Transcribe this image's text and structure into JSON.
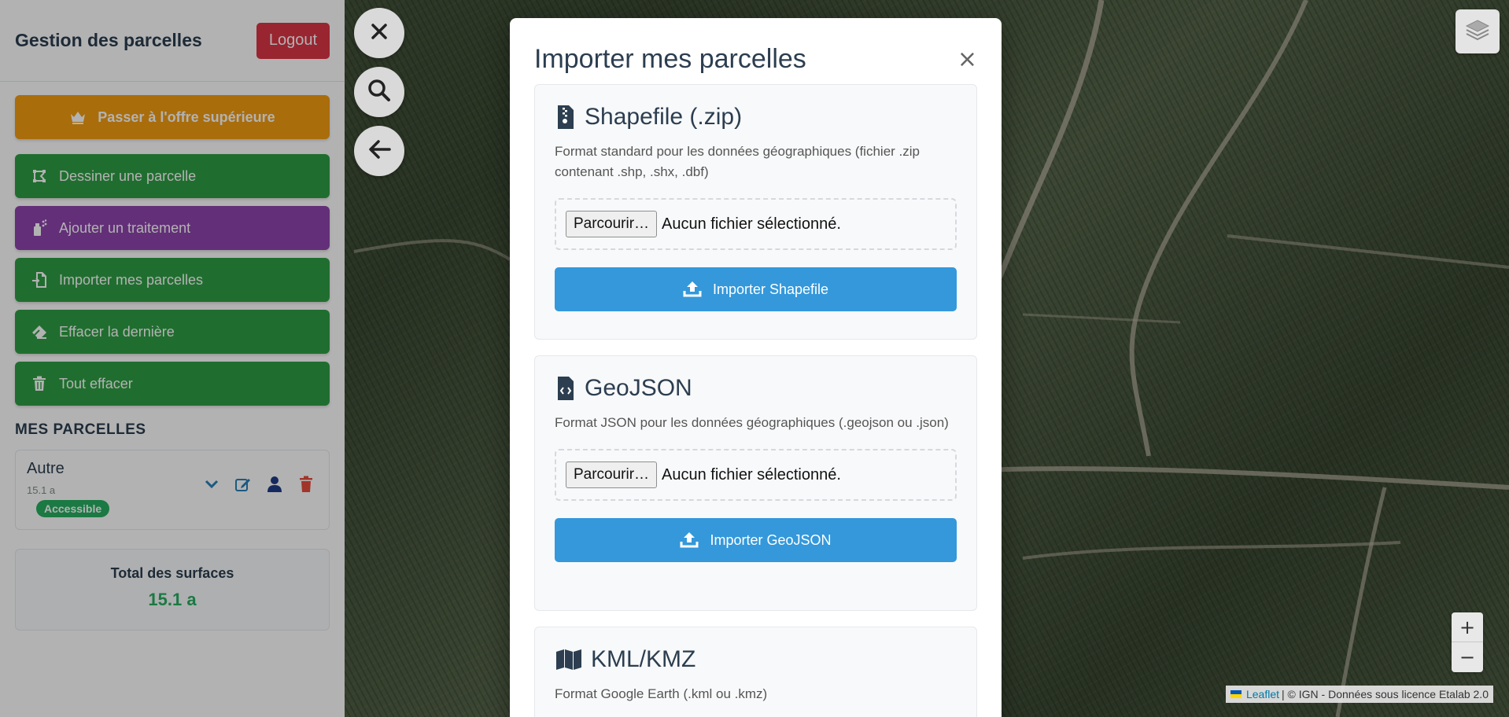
{
  "sidebar": {
    "title": "Gestion des parcelles",
    "logout_label": "Logout",
    "upgrade_label": "Passer à l'offre supérieure",
    "buttons": [
      {
        "label": "Dessiner une parcelle"
      },
      {
        "label": "Ajouter un traitement"
      },
      {
        "label": "Importer mes parcelles"
      },
      {
        "label": "Effacer la dernière"
      },
      {
        "label": "Tout effacer"
      }
    ],
    "section_title": "MES PARCELLES",
    "parcel": {
      "name": "Autre",
      "area": "15.1 a",
      "badge": "Accessible"
    },
    "total": {
      "label": "Total des surfaces",
      "value": "15.1 a"
    }
  },
  "modal": {
    "title": "Importer mes parcelles",
    "close_symbol": "×",
    "cards": [
      {
        "title": "Shapefile (.zip)",
        "description": "Format standard pour les données géographiques (fichier .zip contenant .shp, .shx, .dbf)",
        "file_button": "Parcourir…",
        "file_status": "Aucun fichier sélectionné.",
        "import_label": "Importer Shapefile"
      },
      {
        "title": "GeoJSON",
        "description": "Format JSON pour les données géographiques (.geojson ou .json)",
        "file_button": "Parcourir…",
        "file_status": "Aucun fichier sélectionné.",
        "import_label": "Importer GeoJSON"
      },
      {
        "title": "KML/KMZ",
        "description": "Format Google Earth (.kml ou .kmz)"
      }
    ]
  },
  "map": {
    "zoom_in": "+",
    "zoom_out": "−",
    "attribution_link": "Leaflet",
    "attribution_text": "| © IGN - Données sous licence Etalab 2.0"
  },
  "colors": {
    "upgrade": "#f39c12",
    "green": "#2e9e44",
    "purple": "#8e44ad",
    "logout": "#dc3545",
    "import": "#3498db",
    "badge": "#27ae60"
  }
}
